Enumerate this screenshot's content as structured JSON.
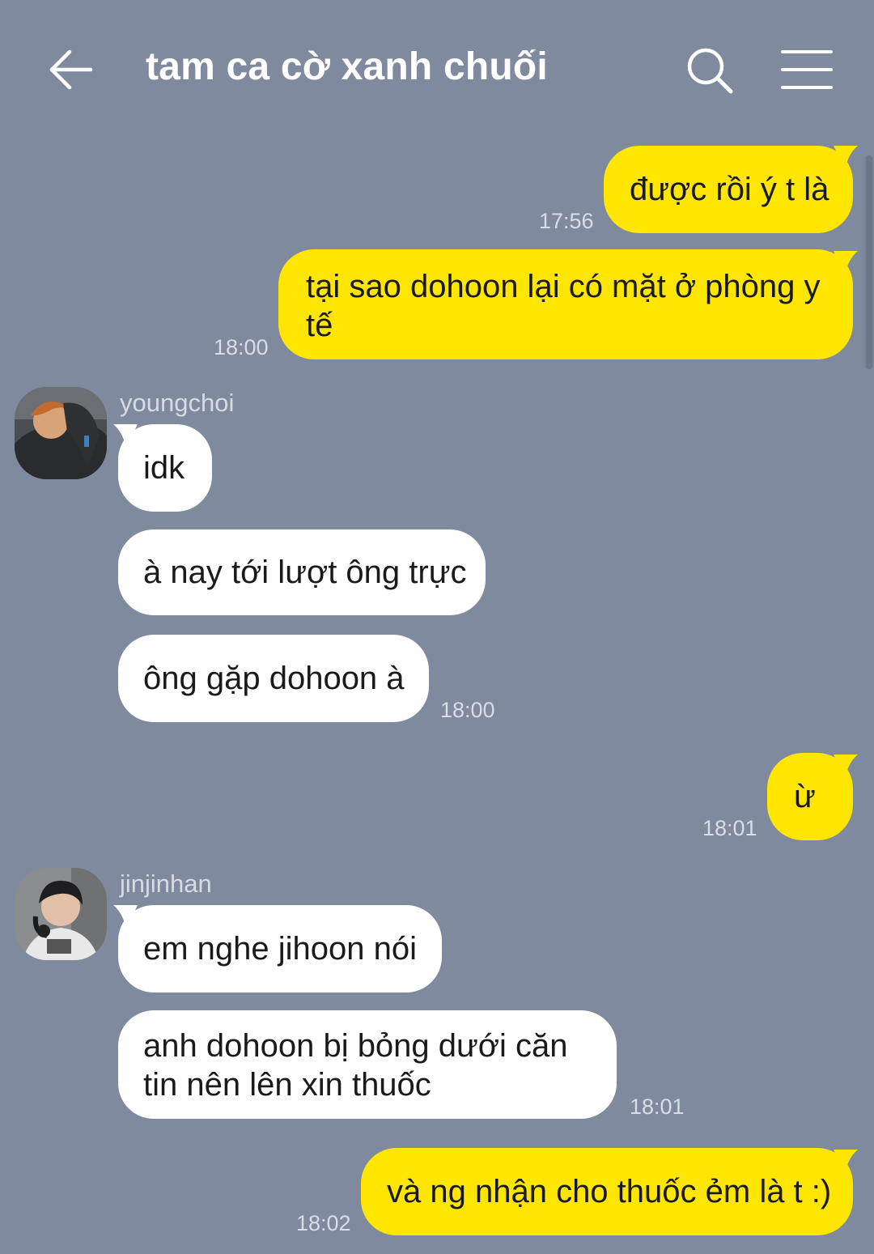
{
  "header": {
    "title": "tam ca cờ xanh chuối",
    "back_icon": "arrow-left-icon",
    "search_icon": "search-icon",
    "menu_icon": "hamburger-menu-icon"
  },
  "colors": {
    "background": "#7f8a9e",
    "outgoing_bubble": "#fee600",
    "incoming_bubble": "#ffffff"
  },
  "messages": [
    {
      "direction": "out",
      "text": "được rồi ý t là",
      "time": "17:56"
    },
    {
      "direction": "out",
      "lines": [
        "tại sao dohoon lại có mặt ở phòng y",
        "tế"
      ],
      "time": "18:00"
    },
    {
      "direction": "in",
      "sender": "youngchoi",
      "text": "idk"
    },
    {
      "direction": "in",
      "text": "à nay tới lượt ông trực"
    },
    {
      "direction": "in",
      "text": "ông gặp dohoon à",
      "time": "18:00"
    },
    {
      "direction": "out",
      "text": "ừ",
      "time": "18:01"
    },
    {
      "direction": "in",
      "sender": "jinjinhan",
      "text": "em nghe jihoon nói"
    },
    {
      "direction": "in",
      "lines": [
        "anh dohoon bị bỏng dưới căn",
        "tin nên lên xin thuốc"
      ],
      "time": "18:01"
    },
    {
      "direction": "out",
      "text": "và ng nhận cho thuốc ẻm là t :)",
      "time": "18:02"
    }
  ]
}
